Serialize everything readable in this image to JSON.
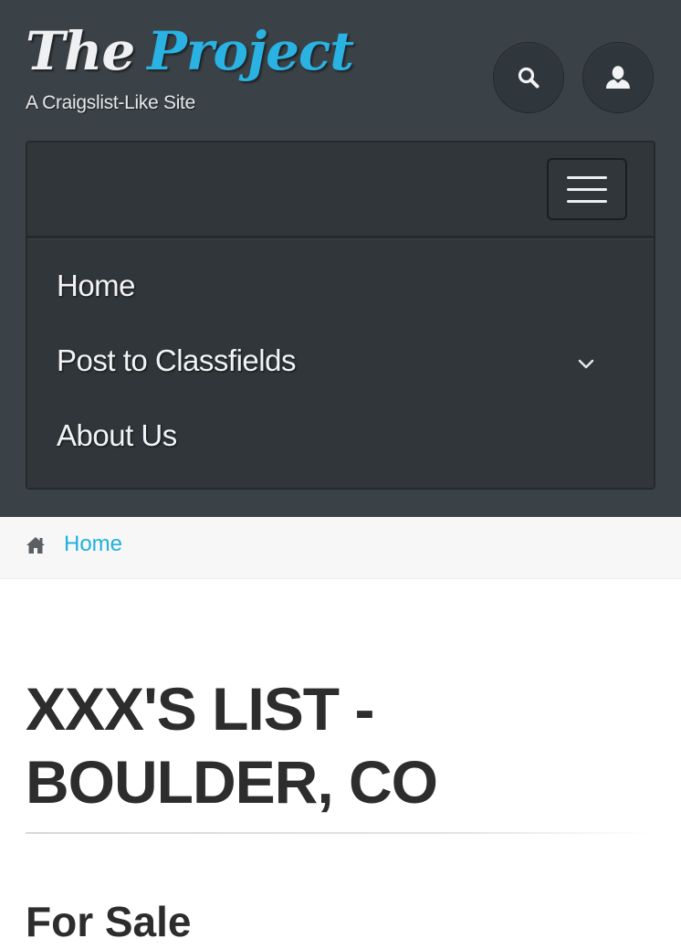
{
  "logo": {
    "word1": "The",
    "word2": "Project",
    "tagline": "A Craigslist-Like Site"
  },
  "header_buttons": {
    "search_icon": "search-icon",
    "user_icon": "user-icon"
  },
  "nav": {
    "toggle_icon": "hamburger-icon",
    "items": [
      {
        "label": "Home"
      },
      {
        "label": "Post to Classfields",
        "has_dropdown": true
      },
      {
        "label": "About Us"
      }
    ]
  },
  "breadcrumb": {
    "icon": "home-icon",
    "label": "Home"
  },
  "main": {
    "title_line1": "XXX'S LIST -",
    "title_line2": "BOULDER, CO",
    "section_heading": "For Sale"
  },
  "colors": {
    "header_bg": "#3b4247",
    "nav_bg": "#30363a",
    "accent": "#1fb1de",
    "logo_accent": "#29b2e2",
    "breadcrumb_bg": "#f7f7f7",
    "heading_text": "#2d2d2d"
  }
}
